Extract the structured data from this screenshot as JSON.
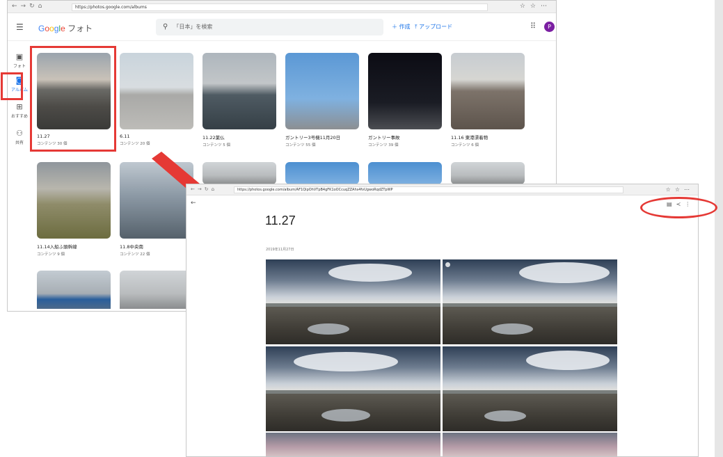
{
  "albums_window": {
    "url": "https://photos.google.com/albums",
    "logo_google": "Google",
    "logo_photos": "フォト",
    "search_placeholder": "「日本」を検索",
    "create_label": "＋ 作成",
    "upload_label": "⤒ アップロード",
    "avatar_letter": "P",
    "sidebar": [
      {
        "label": "フォト",
        "icon": "photo-icon"
      },
      {
        "label": "アルバム",
        "icon": "album-icon"
      },
      {
        "label": "おすすめ",
        "icon": "add-icon"
      },
      {
        "label": "共有",
        "icon": "people-icon"
      }
    ],
    "albums": [
      {
        "title": "11.27",
        "count": "コンテンツ 30 個",
        "art": "constr"
      },
      {
        "title": "6.11",
        "count": "コンテンツ 20 個",
        "art": "bridge"
      },
      {
        "title": "11.22薬仏",
        "count": "コンテンツ 5 個",
        "art": "water"
      },
      {
        "title": "ガントリー3号機11月20日",
        "count": "コンテンツ 55 個",
        "art": "crane"
      },
      {
        "title": "ガントリー事故",
        "count": "コンテンツ 39 個",
        "art": "night"
      },
      {
        "title": "11.16 東港漂着物",
        "count": "コンテンツ 6 個",
        "art": "boat"
      },
      {
        "title": "11.14入船ふ頭幹線",
        "count": "コンテンツ 9 個",
        "art": "grass"
      },
      {
        "title": "11.8中央南",
        "count": "コンテンツ 22 個",
        "art": "coil"
      }
    ]
  },
  "album_window": {
    "url": "https://photos.google.com/album/AF1QipOhVTpB4gFK1oOCcuqZZAhs4fvUgwoRqdZTpWP",
    "title": "11.27",
    "date": "2019年11月27日"
  },
  "colors": {
    "highlight_red": "#e53935",
    "accent_blue": "#1a73e8",
    "avatar_purple": "#7b1fa2"
  }
}
